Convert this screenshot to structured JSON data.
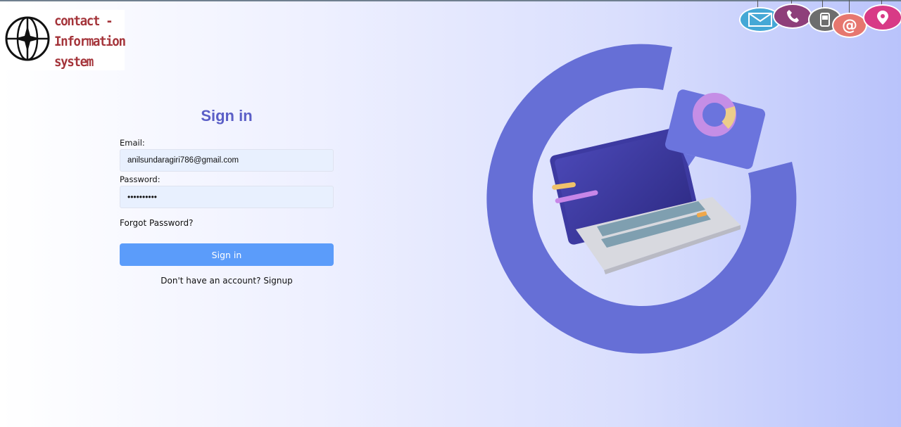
{
  "logo": {
    "line1": "contact -",
    "line2": "Information",
    "line3": "system"
  },
  "form": {
    "title": "Sign in",
    "email_label": "Email:",
    "email_value": "anilsundaragiri786@gmail.com",
    "password_label": "Password:",
    "password_value": "••••••••••",
    "forgot_label": "Forgot Password?",
    "signin_button": "Sign in",
    "signup_prompt": "Don't have an account?",
    "signup_link": "Signup"
  },
  "icons": [
    "envelope-icon",
    "phone-icon",
    "mobile-icon",
    "at-sign-icon",
    "location-pin-icon"
  ],
  "colors": {
    "accent": "#5b5fc7",
    "button": "#5b9cfa",
    "logo_text": "#a4343a",
    "field_bg": "#e8f0fe"
  }
}
